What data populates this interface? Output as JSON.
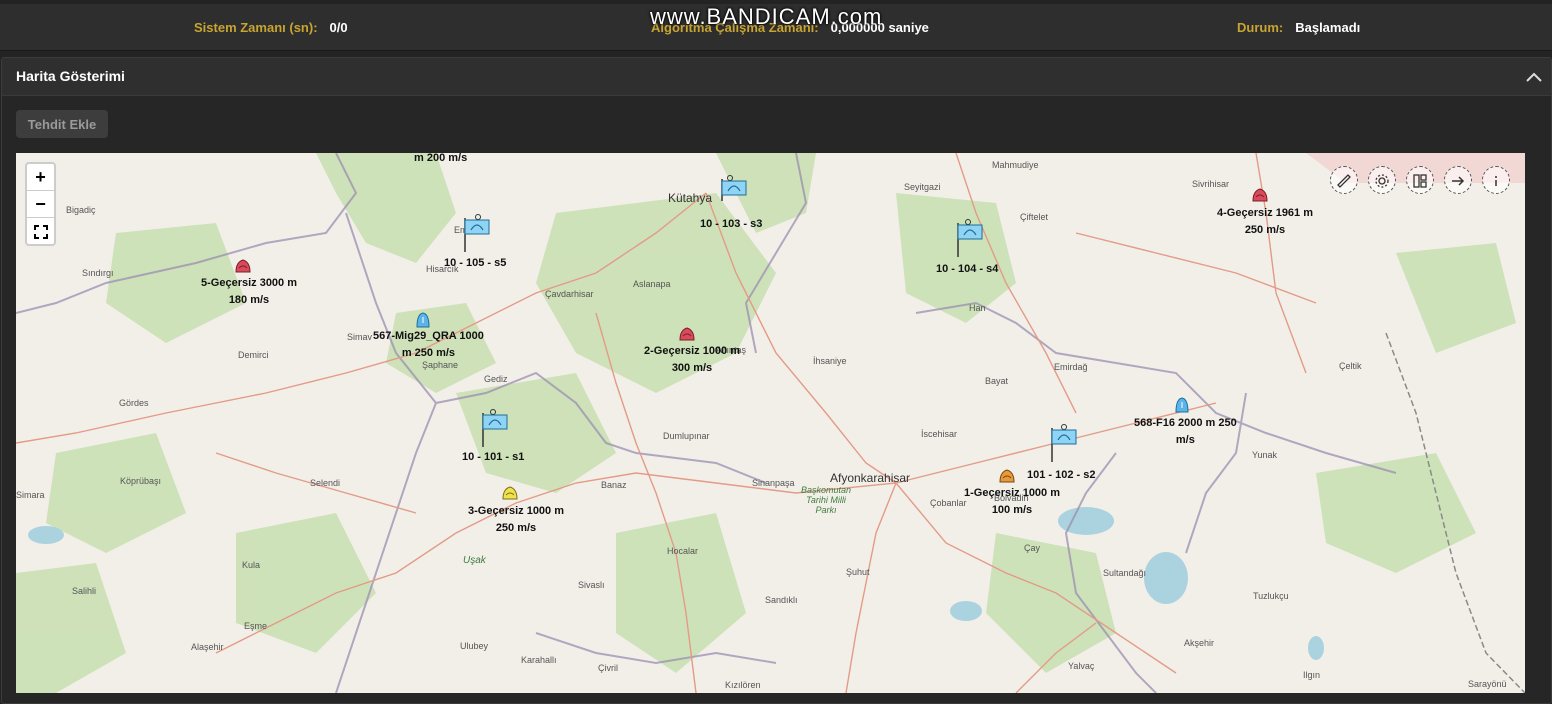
{
  "status": {
    "system_time_label": "Sistem Zamanı (sn):",
    "system_time_value": "0/0",
    "algo_time_label": "Algoritma Çalışma Zamanı:",
    "algo_time_value": "0,000000 saniye",
    "state_label": "Durum:",
    "state_value": "Başlamadı"
  },
  "watermark": "www.BANDICAM.com",
  "panel": {
    "title": "Harita Gösterimi",
    "add_threat_label": "Tehdit Ekle"
  },
  "map": {
    "zoom_in": "+",
    "zoom_out": "−",
    "tools": [
      "ruler-icon",
      "gear-icon",
      "layers-icon",
      "arrow-right-icon",
      "info-icon"
    ],
    "places": [
      "Kütahya",
      "Mahmudiye",
      "Seyitgazi",
      "Sivrihisar",
      "Bigadiç",
      "Emet",
      "Sındırgı",
      "Hisarcık",
      "Çiftelet",
      "Çavdarhisar",
      "Aslanapa",
      "Han",
      "Simav",
      "Demirci",
      "Şaphane",
      "Altıntaş",
      "Gediz",
      "İhsaniye",
      "Bayat",
      "Emirdağ",
      "Çeltik",
      "Gördes",
      "Dumlupınar",
      "İscehisar",
      "Yunak",
      "Köprübaşı",
      "Selendi",
      "Banaz",
      "Sinanpaşa",
      "Afyonkarahisar",
      "Çobanlar",
      "Bolvadin",
      "Uşak",
      "Hocalar",
      "Çay",
      "Sultandağı",
      "Kula",
      "Şuhut",
      "Tuzlukçu",
      "Salihli",
      "Sivaslı",
      "Sandıklı",
      "Eşme",
      "Ulubey",
      "Akşehir",
      "Alaşehir",
      "Karahallı",
      "Yalvaç",
      "Ilgın",
      "Çivril",
      "Kızılören",
      "Sarayönü",
      "Simara"
    ],
    "park_label": "Başkomutan Tarihi Milli Parkı",
    "top_partial_label": "m 200 m/s",
    "radars": [
      {
        "label": "10 - 103 - s3"
      },
      {
        "label": "10 - 105 - s5"
      },
      {
        "label": "10 - 104 - s4"
      },
      {
        "label": "10 - 101 - s1"
      },
      {
        "label": "101 - 102 - s2"
      }
    ],
    "threats": [
      {
        "line1": "4-Geçersiz 1961 m",
        "line2": "250 m/s",
        "color": "#d94b5a"
      },
      {
        "line1": "5-Geçersiz 3000 m",
        "line2": "180 m/s",
        "color": "#d94b5a"
      },
      {
        "line1": "2-Geçersiz 1000 m",
        "line2": "300 m/s",
        "color": "#d94b5a"
      },
      {
        "line1": "3-Geçersiz 1000 m",
        "line2": "250 m/s",
        "color": "#f0e24a"
      },
      {
        "line1": "1-Geçersiz 1000 m",
        "line2": "100 m/s",
        "color": "#e89a3a"
      }
    ],
    "aircraft": [
      {
        "line1": "567-Mig29_QRA 1000",
        "line2": "m 250 m/s",
        "color": "#5ab4ea"
      },
      {
        "line1": "568-F16 2000 m 250",
        "line2": "m/s",
        "color": "#5ab4ea"
      }
    ]
  }
}
